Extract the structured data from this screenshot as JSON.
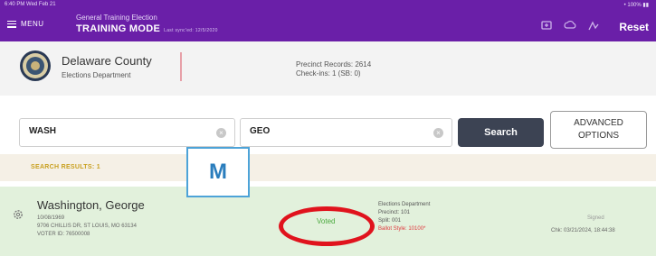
{
  "status_bar": {
    "left": "6:40 PM  Wed Feb 21",
    "right": "• 100% ▮▮"
  },
  "header": {
    "menu_label": "MENU",
    "election_name": "General Training Election",
    "mode_label": "TRAINING MODE",
    "last_sync": "Last sync'ed: 12/5/2020",
    "reset_label": "Reset",
    "icons": [
      "sync-icon",
      "cloud-icon",
      "signal-icon"
    ],
    "bg_color": "#6a1fa8"
  },
  "county": {
    "name": "Delaware County",
    "department": "Elections Department",
    "precinct_records": "Precinct Records: 2614",
    "checkins": "Check-ins: 1 (SB: 0)"
  },
  "search": {
    "last_name": "WASH",
    "first_name": "GEO",
    "search_label": "Search",
    "advanced_label": "ADVANCED\nOPTIONS"
  },
  "results": {
    "header": "SEARCH RESULTS: 1",
    "items": [
      {
        "name": "Washington, George",
        "dob": "10/08/1969",
        "address": "9706 CHILLIS DR, ST LOUIS, MO 63134",
        "voter_id": "VOTER ID: 76500008",
        "status": "Voted",
        "location": "Elections Department",
        "precinct": "Precinct: 101",
        "split": "Split: 001",
        "ballot_style": "Ballot Style: 10100*",
        "signed_label": "Signed",
        "checkin_time": "Chk: 03/21/2024, 18:44:38"
      }
    ]
  },
  "annotation": {
    "letter": "M"
  },
  "colors": {
    "voted": "#4aa93e",
    "accent": "#6a1fa8",
    "highlight_ring": "#e0131d",
    "results_header": "#c9a020"
  }
}
